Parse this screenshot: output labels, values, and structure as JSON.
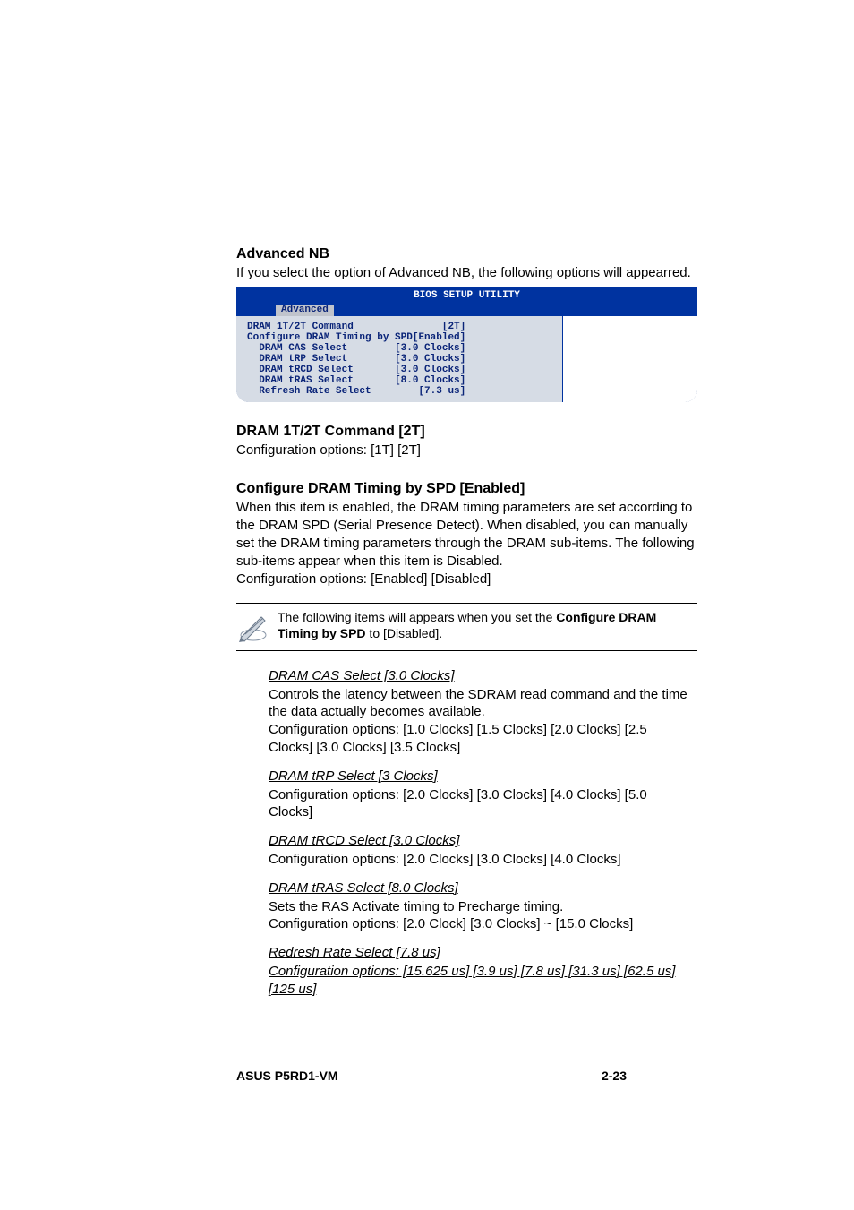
{
  "section": {
    "title": "Advanced NB"
  },
  "intro": "If you select the option of Advanced NB, the following options will appearred.",
  "bios": {
    "title": "BIOS SETUP UTILITY",
    "tab": "Advanced",
    "rows": [
      {
        "label": "DRAM 1T/2T Command",
        "value": "[2T]"
      },
      {
        "label": "Configure DRAM Timing by SPD",
        "value": "[Enabled]"
      },
      {
        "label": "  DRAM CAS Select",
        "value": "[3.0 Clocks]"
      },
      {
        "label": "  DRAM tRP Select",
        "value": "[3.0 Clocks]"
      },
      {
        "label": "  DRAM tRCD Select",
        "value": "[3.0 Clocks]"
      },
      {
        "label": "  DRAM tRAS Select",
        "value": "[8.0 Clocks]"
      },
      {
        "label": "  Refresh Rate Select",
        "value": "[7.3 us]"
      }
    ]
  },
  "chart_data": {
    "type": "table",
    "title": "BIOS SETUP UTILITY — Advanced",
    "categories": [
      "Setting",
      "Value"
    ],
    "series": [
      {
        "name": "DRAM 1T/2T Command",
        "values": [
          "2T"
        ]
      },
      {
        "name": "Configure DRAM Timing by SPD",
        "values": [
          "Enabled"
        ]
      },
      {
        "name": "DRAM CAS Select",
        "values": [
          "3.0 Clocks"
        ]
      },
      {
        "name": "DRAM tRP Select",
        "values": [
          "3.0 Clocks"
        ]
      },
      {
        "name": "DRAM tRCD Select",
        "values": [
          "3.0 Clocks"
        ]
      },
      {
        "name": "DRAM tRAS Select",
        "values": [
          "8.0 Clocks"
        ]
      },
      {
        "name": "Refresh Rate Select",
        "values": [
          "7.3 us"
        ]
      }
    ]
  },
  "settings": {
    "s1": {
      "head": "DRAM 1T/2T Command [2T]",
      "body": "Configuration options: [1T] [2T]"
    },
    "s2": {
      "head": "Configure DRAM Timing by SPD [Enabled]",
      "body": "When this item is enabled, the DRAM timing parameters are set according to the DRAM SPD (Serial Presence Detect). When disabled, you can manually set the DRAM timing parameters through the DRAM sub-items. The following sub-items appear when this item is Disabled.\nConfiguration options: [Enabled] [Disabled]"
    }
  },
  "note": {
    "pre": "The following items will appears when you set the ",
    "bold": "Configure DRAM Timing by SPD",
    "post": " to [Disabled]."
  },
  "sub": {
    "cas": {
      "head": "DRAM CAS Select [3.0 Clocks]",
      "body": "Controls the latency between the SDRAM read command and the time the data actually becomes available.\nConfiguration options: [1.0 Clocks] [1.5 Clocks] [2.0 Clocks] [2.5 Clocks] [3.0 Clocks] [3.5 Clocks]"
    },
    "trp": {
      "head": "DRAM tRP Select [3 Clocks]",
      "body": "Configuration options: [2.0 Clocks] [3.0 Clocks] [4.0 Clocks] [5.0 Clocks]"
    },
    "trcd": {
      "head": "DRAM tRCD Select [3.0 Clocks]",
      "body": "Configuration options: [2.0 Clocks] [3.0 Clocks]  [4.0 Clocks]"
    },
    "tras": {
      "head": "DRAM tRAS Select [8.0 Clocks]",
      "body": "Sets the RAS Activate timing to Precharge timing.\nConfiguration options: [2.0 Clock] [3.0 Clocks] ~ [15.0 Clocks]"
    },
    "refresh": {
      "head": "Redresh Rate Select [7.8 us]",
      "body": "Configuration options: [15.625 us] [3.9 us] [7.8 us] [31.3 us] [62.5 us] [125 us]"
    }
  },
  "footer": {
    "left": "ASUS P5RD1-VM",
    "right": "2-23"
  }
}
